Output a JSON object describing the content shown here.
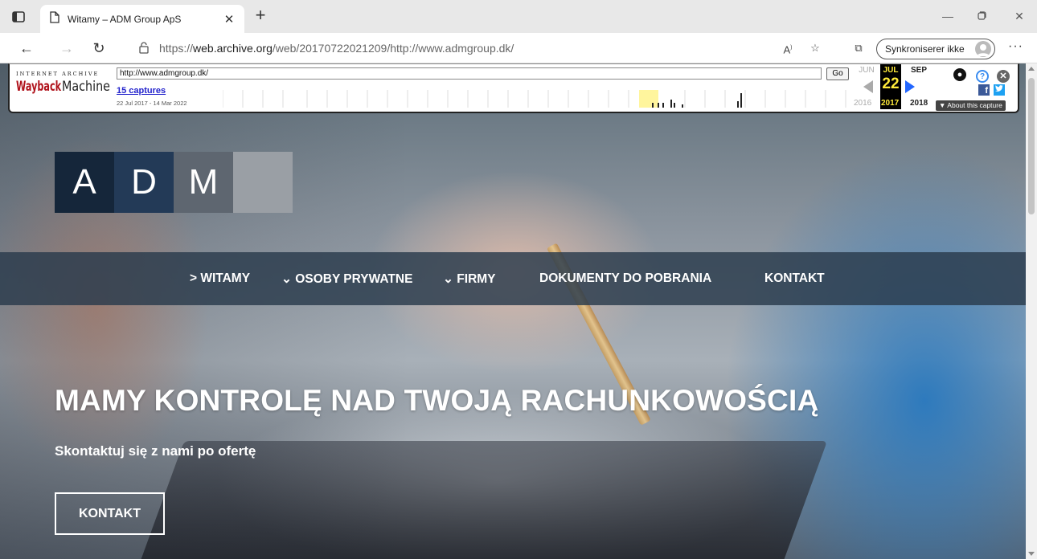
{
  "browser": {
    "tab_title": "Witamy – ADM Group ApS",
    "new_tab_label": "+",
    "url_prefix": "https://",
    "url_host": "web.archive.org",
    "url_path": "/web/20170722021209/http://www.admgroup.dk/",
    "sync_label": "Synkroniserer ikke",
    "more_label": "···"
  },
  "wayback": {
    "logo_top": "INTERNET ARCHIVE",
    "logo_text": "WaybackMachine",
    "url_value": "http://www.admgroup.dk/",
    "go_label": "Go",
    "captures": "15 captures",
    "range": "22 Jul 2017 - 14 Mar 2022",
    "prev_month": "JUN",
    "current_month": "JUL",
    "next_month": "SEP",
    "day": "22",
    "prev_year": "2016",
    "current_year": "2017",
    "next_year": "2018",
    "about_label": "▼ About this capture",
    "facebook_label": "f"
  },
  "site": {
    "logo_letters": [
      "A",
      "D",
      "M"
    ],
    "nav": {
      "witamy": "> WITAMY",
      "osoby": "⌄ OSOBY PRYWATNE",
      "firmy": "⌄ FIRMY",
      "dokumenty": "DOKUMENTY DO POBRANIA",
      "kontakt": "KONTAKT"
    },
    "headline": "MAMY KONTROLĘ NAD TWOJĄ RACHUNKOWOŚCIĄ",
    "subline": "Skontaktuj się z nami po ofertę",
    "cta_label": "KONTAKT"
  },
  "colors": {
    "logo_a": "#15263a",
    "logo_d": "#233a57",
    "logo_m": "#5e6670",
    "nav_bg": "#2a3a4c",
    "wayback_year_highlight": "#ffeb3b"
  }
}
